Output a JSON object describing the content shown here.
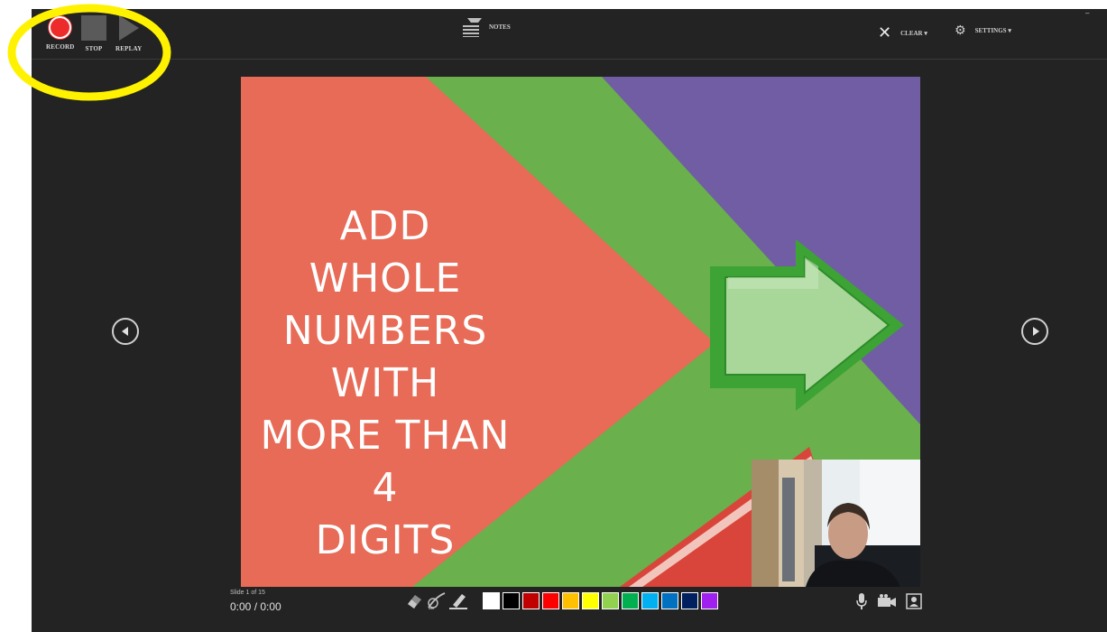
{
  "toolbar": {
    "record_label": "RECORD",
    "stop_label": "STOP",
    "replay_label": "REPLAY",
    "notes_label": "NOTES",
    "clear_label": "CLEAR ▾",
    "settings_label": "SETTINGS ▾"
  },
  "slide": {
    "title_lines": [
      "ADD WHOLE",
      "NUMBERS WITH",
      "MORE THAN 4",
      "DIGITS"
    ]
  },
  "footer": {
    "slide_counter": "Slide 1 of 15",
    "timer": "0:00 / 0:00"
  },
  "icons": {
    "prev": "chevron-left-circle-icon",
    "next": "chevron-right-circle-icon",
    "clear": "close-icon",
    "settings": "gear-icon",
    "notes": "notes-icon",
    "eraser": "eraser-icon",
    "pen": "pen-icon",
    "highlighter": "highlighter-icon",
    "mic": "microphone-icon",
    "camera": "video-camera-icon",
    "preview": "camera-preview-icon"
  },
  "ink_colors": [
    "#ffffff",
    "#000000",
    "#c00000",
    "#ff0000",
    "#ffc000",
    "#ffff00",
    "#92d050",
    "#00b050",
    "#00b0f0",
    "#0070c0",
    "#002060",
    "#a020f0"
  ],
  "colors": {
    "accent_record": "#ee2b2b",
    "slide_red": "#e76b56",
    "slide_green": "#6ab04c",
    "slide_purple": "#705da3",
    "highlight_circle": "#fff200"
  }
}
